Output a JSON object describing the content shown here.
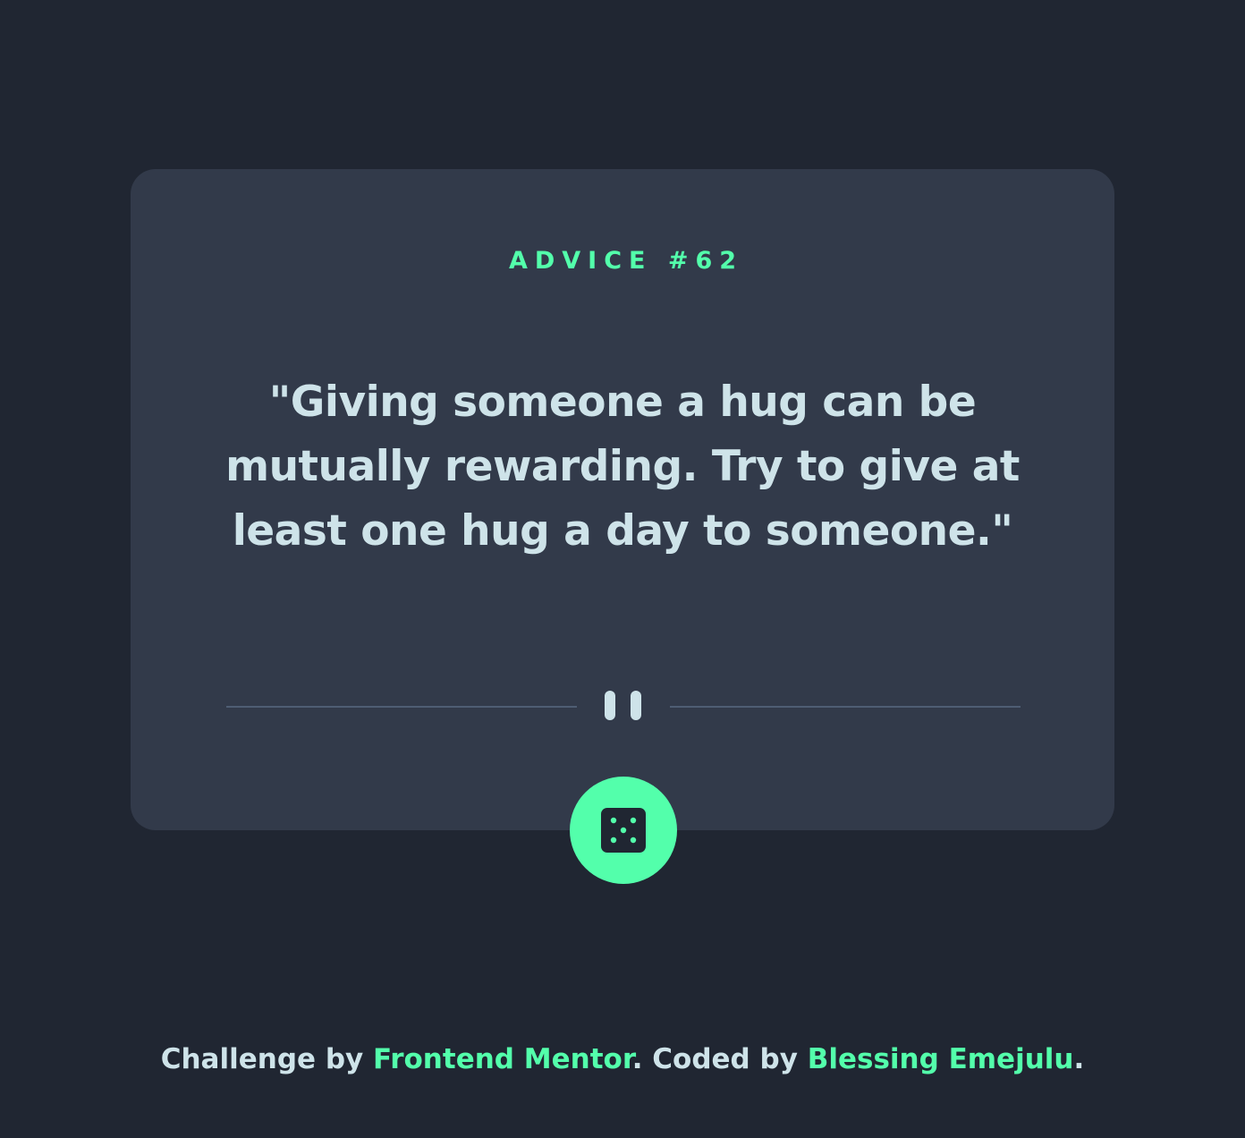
{
  "advice": {
    "label": "ADVICE #62",
    "quote": "\"Giving someone a hug can be mutually rewarding. Try to give at least one hug a day to someone.\""
  },
  "divider": {
    "icon": "pause-icon"
  },
  "dice_button": {
    "icon": "dice-icon"
  },
  "footer": {
    "prefix": "Challenge by ",
    "challenge_link": "Frontend Mentor",
    "middle": ". Coded by ",
    "author_link": "Blessing Emejulu",
    "suffix": "."
  },
  "colors": {
    "background": "#202632",
    "card": "#323a4a",
    "accent": "#53ffab",
    "text": "#cee3e9",
    "divider": "#4e5d73"
  }
}
